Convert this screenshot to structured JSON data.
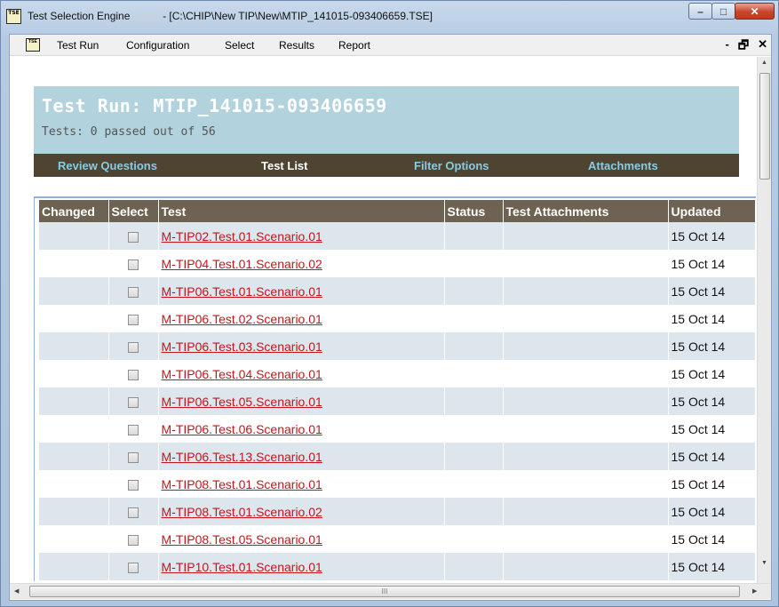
{
  "window": {
    "app_name": "Test Selection Engine",
    "title_path": "- [C:\\CHIP\\New TIP\\New\\MTIP_141015-093406659.TSE]",
    "icon_text": "TSE",
    "minimize": "–",
    "maximize": "□",
    "close": "✕"
  },
  "menubar": {
    "icon_text": "TSE",
    "items": [
      "Test Run",
      "Configuration",
      "Select",
      "Results",
      "Report"
    ],
    "mdi_minimize": "-",
    "mdi_restore": "🗗",
    "mdi_close": "✕"
  },
  "header": {
    "title": "Test Run: MTIP_141015-093406659",
    "subtitle": "Tests: 0 passed out of 56"
  },
  "tabs": [
    {
      "label": "Review Questions",
      "active": false
    },
    {
      "label": "Test List",
      "active": true
    },
    {
      "label": "Filter Options",
      "active": false
    },
    {
      "label": "Attachments",
      "active": false
    }
  ],
  "table": {
    "columns": [
      "Changed",
      "Select",
      "Test",
      "Status",
      "Test Attachments",
      "Updated"
    ],
    "rows": [
      {
        "changed": "",
        "test": "M-TIP02.Test.01.Scenario.01",
        "status": "",
        "attachments": "",
        "updated": "15 Oct 14"
      },
      {
        "changed": "",
        "test": "M-TIP04.Test.01.Scenario.02",
        "status": "",
        "attachments": "",
        "updated": "15 Oct 14"
      },
      {
        "changed": "",
        "test": "M-TIP06.Test.01.Scenario.01",
        "status": "",
        "attachments": "",
        "updated": "15 Oct 14"
      },
      {
        "changed": "",
        "test": "M-TIP06.Test.02.Scenario.01",
        "status": "",
        "attachments": "",
        "updated": "15 Oct 14"
      },
      {
        "changed": "",
        "test": "M-TIP06.Test.03.Scenario.01",
        "status": "",
        "attachments": "",
        "updated": "15 Oct 14"
      },
      {
        "changed": "",
        "test": "M-TIP06.Test.04.Scenario.01",
        "status": "",
        "attachments": "",
        "updated": "15 Oct 14"
      },
      {
        "changed": "",
        "test": "M-TIP06.Test.05.Scenario.01",
        "status": "",
        "attachments": "",
        "updated": "15 Oct 14"
      },
      {
        "changed": "",
        "test": "M-TIP06.Test.06.Scenario.01",
        "status": "",
        "attachments": "",
        "updated": "15 Oct 14"
      },
      {
        "changed": "",
        "test": "M-TIP06.Test.13.Scenario.01",
        "status": "",
        "attachments": "",
        "updated": "15 Oct 14"
      },
      {
        "changed": "",
        "test": "M-TIP08.Test.01.Scenario.01",
        "status": "",
        "attachments": "",
        "updated": "15 Oct 14"
      },
      {
        "changed": "",
        "test": "M-TIP08.Test.01.Scenario.02",
        "status": "",
        "attachments": "",
        "updated": "15 Oct 14"
      },
      {
        "changed": "",
        "test": "M-TIP08.Test.05.Scenario.01",
        "status": "",
        "attachments": "",
        "updated": "15 Oct 14"
      },
      {
        "changed": "",
        "test": "M-TIP10.Test.01.Scenario.01",
        "status": "",
        "attachments": "",
        "updated": "15 Oct 14"
      }
    ]
  },
  "scrollbars": {
    "up_arrow": "▲",
    "down_arrow": "▼",
    "left_arrow": "◀",
    "right_arrow": "▶",
    "grip": "III"
  },
  "colors": {
    "header_panel": "#b2d3dd",
    "tab_bar": "#4f4331",
    "tab_inactive": "#84cde4",
    "table_header": "#6e6352",
    "row_alt": "#dde6ec",
    "link": "#c4161c"
  }
}
